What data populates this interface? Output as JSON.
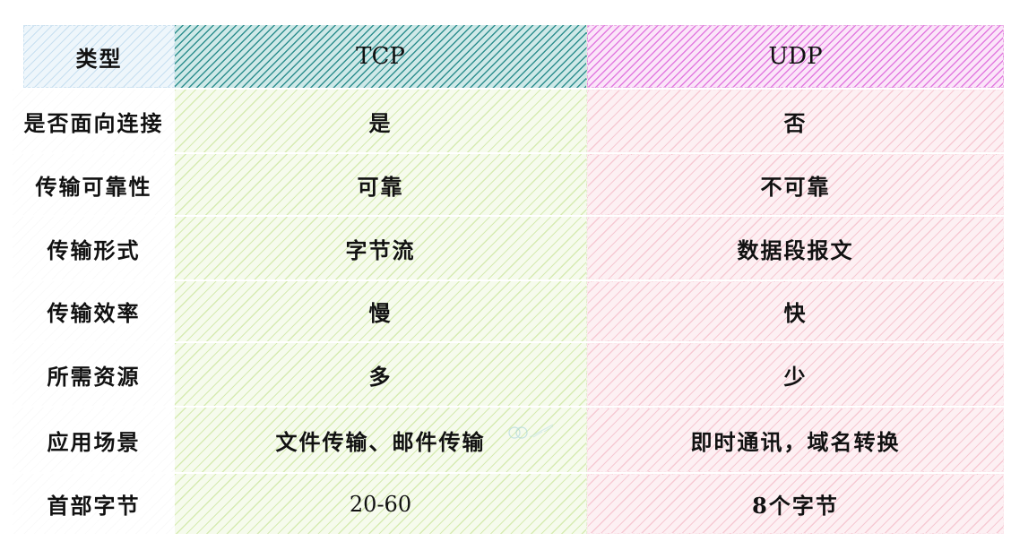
{
  "table": {
    "header": {
      "label": "类型",
      "tcp": "TCP",
      "udp": "UDP"
    },
    "rows": [
      {
        "label": "是否面向连接",
        "tcp": "是",
        "udp": "否"
      },
      {
        "label": "传输可靠性",
        "tcp": "可靠",
        "udp": "不可靠"
      },
      {
        "label": "传输形式",
        "tcp": "字节流",
        "udp": "数据段报文"
      },
      {
        "label": "传输效率",
        "tcp": "慢",
        "udp": "快"
      },
      {
        "label": "所需资源",
        "tcp": "多",
        "udp": "少"
      },
      {
        "label": "应用场景",
        "tcp": "文件传输、邮件传输",
        "udp": "即时通讯，域名转换"
      },
      {
        "label": "首部字节",
        "tcp": "20-60",
        "udp": "8个字节"
      }
    ]
  },
  "colors": {
    "header_label": "#c7dff0",
    "header_tcp": "#2f8f8f",
    "header_udp": "#e27be0",
    "body_tcp": "#d6ebb2",
    "body_udp": "#f6c9d3"
  },
  "watermark": {
    "icon": "logo-icon"
  }
}
